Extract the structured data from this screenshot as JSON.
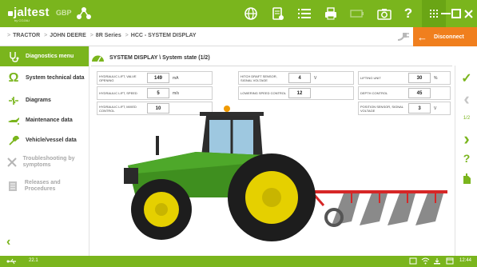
{
  "brand": {
    "logo_text": "jaltest",
    "logo_sub": "by COJALI",
    "region": "GBP"
  },
  "breadcrumb": [
    "TRACTOR",
    "JOHN DEERE",
    "8R Series",
    "HCC - SYSTEM DISPLAY"
  ],
  "header": {
    "disconnect_label": "Disconnect"
  },
  "sidebar": {
    "items": [
      {
        "label": "Diagnostics menu",
        "icon": "stethoscope-icon",
        "state": "active"
      },
      {
        "label": "System technical data",
        "icon": "ohm-icon",
        "state": "normal"
      },
      {
        "label": "Diagrams",
        "icon": "diagram-icon",
        "state": "normal"
      },
      {
        "label": "Maintenance data",
        "icon": "oil-can-icon",
        "state": "normal"
      },
      {
        "label": "Vehicle/vessel data",
        "icon": "wrench-icon",
        "state": "normal"
      },
      {
        "label": "Troubleshooting by symptoms",
        "icon": "tools-icon",
        "state": "disabled"
      },
      {
        "label": "Releases and Procedures",
        "icon": "document-icon",
        "state": "disabled"
      }
    ]
  },
  "main": {
    "title": "SYSTEM DISPLAY \\ System state (1/2)",
    "params": [
      {
        "label": "HYDRAULIC LIFT, VALVE OPENING",
        "value": "149",
        "unit": "mA"
      },
      {
        "label": "HYDRAULIC LIFT, SPEED",
        "value": "5",
        "unit": "m/s"
      },
      {
        "label": "HYDRAULIC LIFT, MIXED CONTROL",
        "value": "10",
        "unit": ""
      },
      {
        "label": "HITCH DRAFT SENSOR, SIGNAL VOLTAGE",
        "value": "4",
        "unit": "V"
      },
      {
        "label": "LOWERING SPEED CONTROL",
        "value": "12",
        "unit": ""
      },
      {
        "label": "LIFTING UNIT",
        "value": "30",
        "unit": "%"
      },
      {
        "label": "DEPTH CONTROL",
        "value": "45",
        "unit": ""
      },
      {
        "label": "POSITION SENSOR, SIGNAL VOLTAGE",
        "value": "3",
        "unit": "V"
      }
    ]
  },
  "rail": {
    "page": "1/2"
  },
  "status": {
    "version": "22.1",
    "time": "12:44"
  },
  "colors": {
    "accent": "#7ab51d",
    "orange": "#f07f1e",
    "tractor_green": "#3f8f1f",
    "wheel_yellow": "#e5d000"
  }
}
